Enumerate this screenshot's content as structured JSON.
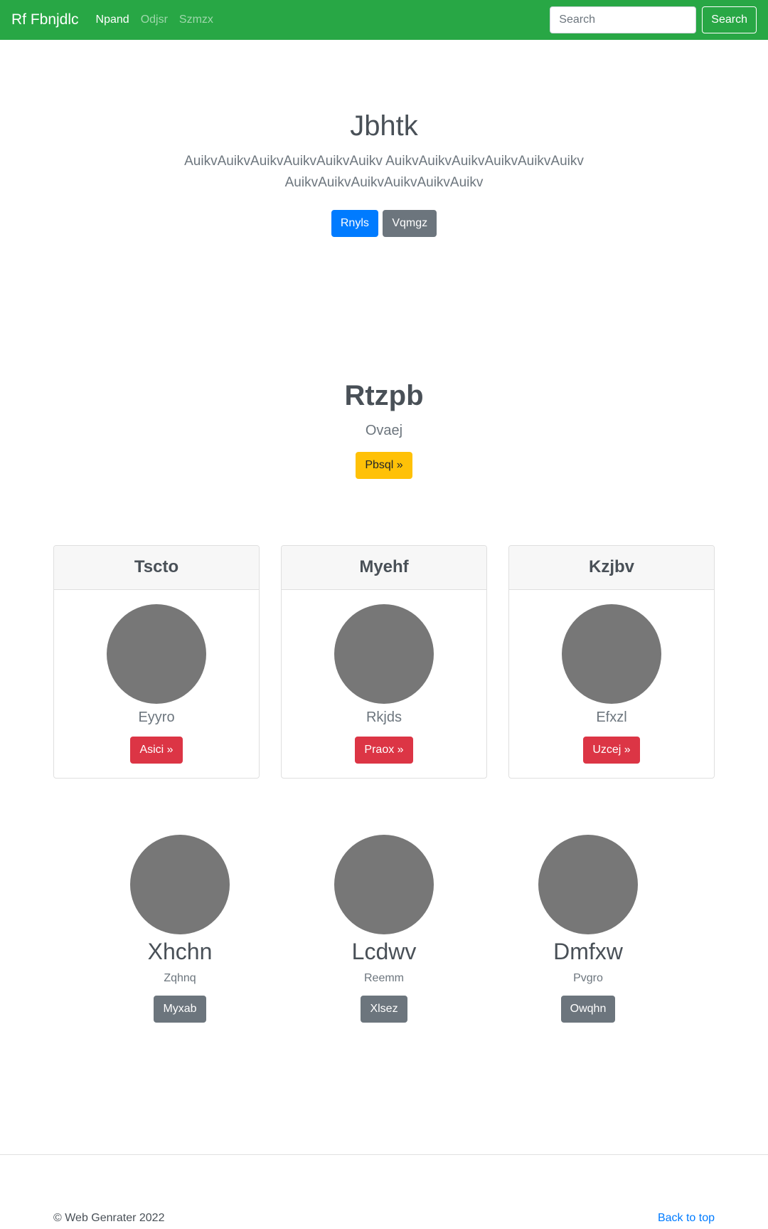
{
  "navbar": {
    "brand": "Rf Fbnjdlc",
    "links": [
      {
        "label": "Npand",
        "active": true
      },
      {
        "label": "Odjsr",
        "active": false
      },
      {
        "label": "Szmzx",
        "active": false
      }
    ],
    "search_placeholder": "Search",
    "search_button": "Search"
  },
  "hero": {
    "title": "Jbhtk",
    "lead": "AuikvAuikvAuikvAuikvAuikvAuikv AuikvAuikvAuikvAuikvAuikvAuikv AuikvAuikvAuikvAuikvAuikvAuikv",
    "primary_button": "Rnyls",
    "secondary_button": "Vqmgz"
  },
  "feature": {
    "title": "Rtzpb",
    "subtitle": "Ovaej",
    "button": "Pbsql »"
  },
  "cards": [
    {
      "header": "Tscto",
      "caption": "Eyyro",
      "button": "Asici »"
    },
    {
      "header": "Myehf",
      "caption": "Rkjds",
      "button": "Praox »"
    },
    {
      "header": "Kzjbv",
      "caption": "Efxzl",
      "button": "Uzcej »"
    }
  ],
  "team": [
    {
      "name": "Xhchn",
      "role": "Zqhnq",
      "button": "Myxab"
    },
    {
      "name": "Lcdwv",
      "role": "Reemm",
      "button": "Xlsez"
    },
    {
      "name": "Dmfxw",
      "role": "Pvgro",
      "button": "Owqhn"
    }
  ],
  "footer": {
    "copyright": "© Web Genrater 2022",
    "back_to_top": "Back to top"
  },
  "colors": {
    "navbar": "#28a745",
    "primary": "#007bff",
    "secondary": "#6c757d",
    "warning": "#ffc107",
    "danger": "#dc3545",
    "placeholder_image": "#777777"
  }
}
